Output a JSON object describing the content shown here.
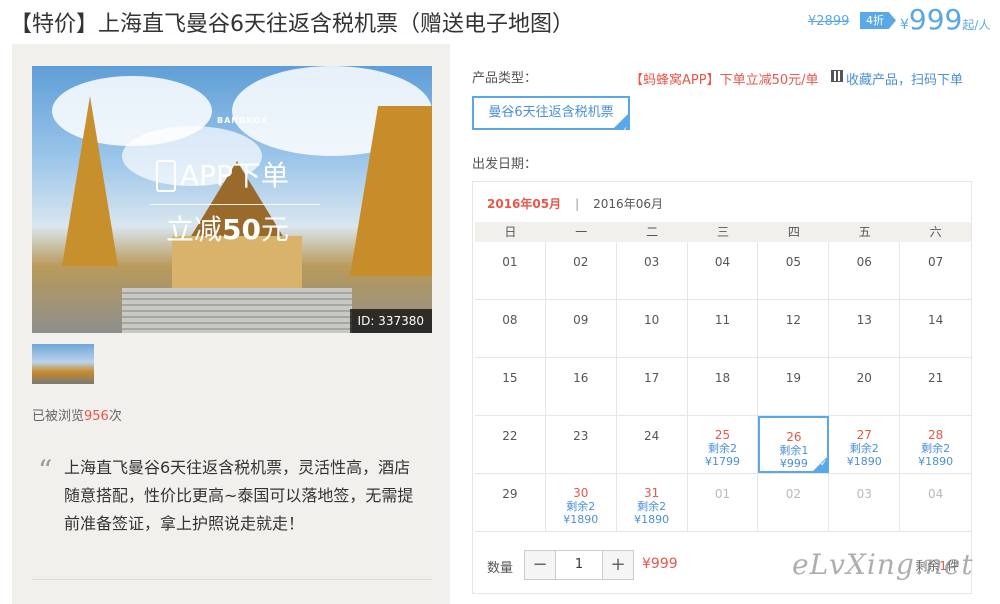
{
  "header": {
    "title": "【特价】上海直飞曼谷6天往返含税机票（赠送电子地图）",
    "price_old": "¥2899",
    "discount": "4折",
    "currency": "¥",
    "price_now": "999",
    "price_unit": "起/人"
  },
  "gallery": {
    "overlay_line1": "APP下单",
    "overlay_line2_prefix": "立减",
    "overlay_line2_amount": "50",
    "overlay_line2_suffix": "元",
    "image_text": "BANGKOK",
    "image_id": "ID: 337380"
  },
  "views": {
    "prefix": "已被浏览",
    "count": "956",
    "suffix": "次"
  },
  "description": "上海直飞曼谷6天往返含税机票，灵活性高，酒店随意搭配，性价比更高~泰国可以落地签，无需提前准备签证，拿上护照说走就走！",
  "product": {
    "type_label": "产品类型：",
    "promo": "【蚂蜂窝APP】下单立减50元/单",
    "collect": "收藏产品，扫码下单",
    "selected_type": "曼谷6天往返含税机票",
    "date_label": "出发日期："
  },
  "calendar": {
    "month_active": "2016年05月",
    "separator": "|",
    "month_next": "2016年06月",
    "weekdays": [
      "日",
      "一",
      "二",
      "三",
      "四",
      "五",
      "六"
    ],
    "rows": [
      [
        {
          "d": "01"
        },
        {
          "d": "02"
        },
        {
          "d": "03"
        },
        {
          "d": "04"
        },
        {
          "d": "05"
        },
        {
          "d": "06"
        },
        {
          "d": "07"
        }
      ],
      [
        {
          "d": "08"
        },
        {
          "d": "09"
        },
        {
          "d": "10"
        },
        {
          "d": "11"
        },
        {
          "d": "12"
        },
        {
          "d": "13"
        },
        {
          "d": "14"
        }
      ],
      [
        {
          "d": "15"
        },
        {
          "d": "16"
        },
        {
          "d": "17"
        },
        {
          "d": "18"
        },
        {
          "d": "19"
        },
        {
          "d": "20"
        },
        {
          "d": "21"
        }
      ],
      [
        {
          "d": "22"
        },
        {
          "d": "23"
        },
        {
          "d": "24"
        },
        {
          "d": "25",
          "left": "剩余2",
          "price": "¥1799"
        },
        {
          "d": "26",
          "left": "剩余1",
          "price": "¥999",
          "selected": true
        },
        {
          "d": "27",
          "left": "剩余2",
          "price": "¥1890"
        },
        {
          "d": "28",
          "left": "剩余2",
          "price": "¥1890"
        }
      ],
      [
        {
          "d": "29"
        },
        {
          "d": "30",
          "left": "剩余2",
          "price": "¥1890"
        },
        {
          "d": "31",
          "left": "剩余2",
          "price": "¥1890"
        },
        {
          "d": "01",
          "past": true
        },
        {
          "d": "02",
          "past": true
        },
        {
          "d": "03",
          "past": true
        },
        {
          "d": "04",
          "past": true
        }
      ]
    ]
  },
  "quantity": {
    "label": "数量",
    "minus": "−",
    "value": "1",
    "plus": "+",
    "total": "¥999",
    "remain_prefix": "剩余",
    "remain_count": "1",
    "remain_suffix": "件"
  },
  "watermark": "eLvXing.net"
}
